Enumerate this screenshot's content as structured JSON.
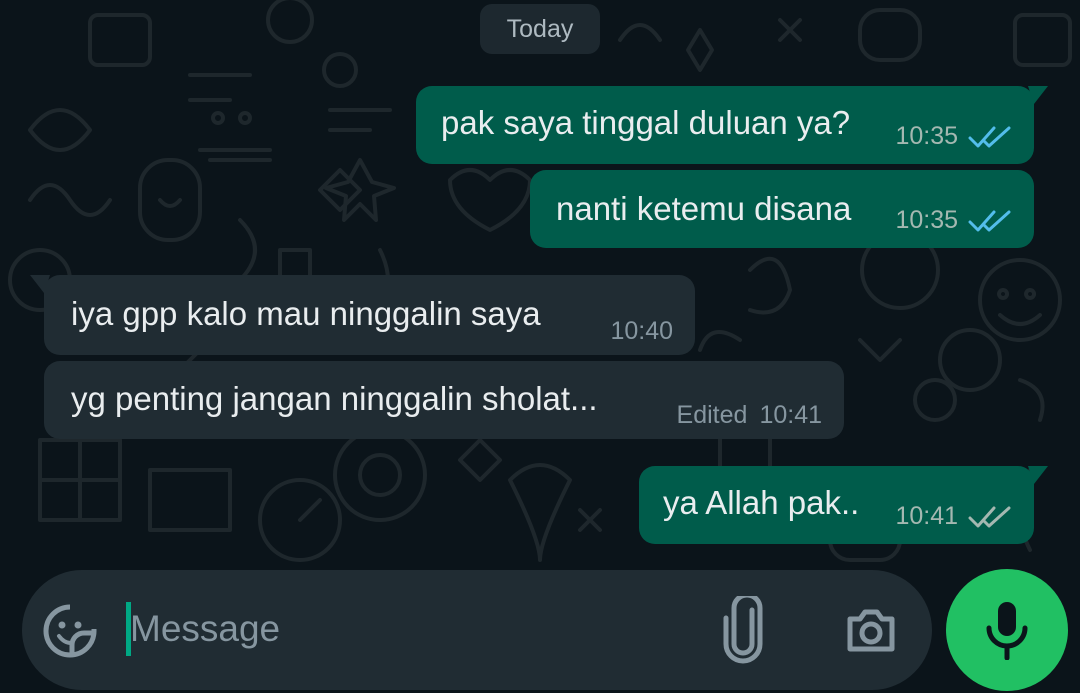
{
  "date_separator": "Today",
  "colors": {
    "background": "#0b141a",
    "outgoing_bubble": "#005c4b",
    "incoming_bubble": "#202c33",
    "read_tick": "#53bdeb",
    "delivered_tick": "#a4b8b1",
    "mic_button": "#21c063",
    "caret": "#00a884"
  },
  "messages": [
    {
      "direction": "outgoing",
      "text": "pak saya tinggal duluan ya?",
      "time": "10:35",
      "status": "read",
      "status_icon": "double-check-icon"
    },
    {
      "direction": "outgoing",
      "text": "nanti ketemu disana",
      "time": "10:35",
      "status": "read",
      "status_icon": "double-check-icon"
    },
    {
      "direction": "incoming",
      "text": "iya gpp kalo mau ninggalin saya",
      "time": "10:40"
    },
    {
      "direction": "incoming",
      "text": "yg penting jangan ninggalin sholat...",
      "time": "10:41",
      "edited_label": "Edited"
    },
    {
      "direction": "outgoing",
      "text": "ya Allah pak..",
      "time": "10:41",
      "status": "delivered",
      "status_icon": "double-check-icon"
    }
  ],
  "composer": {
    "placeholder": "Message",
    "value": "",
    "sticker_icon": "sticker-icon",
    "attach_icon": "paperclip-icon",
    "camera_icon": "camera-icon",
    "mic_icon": "microphone-icon"
  }
}
